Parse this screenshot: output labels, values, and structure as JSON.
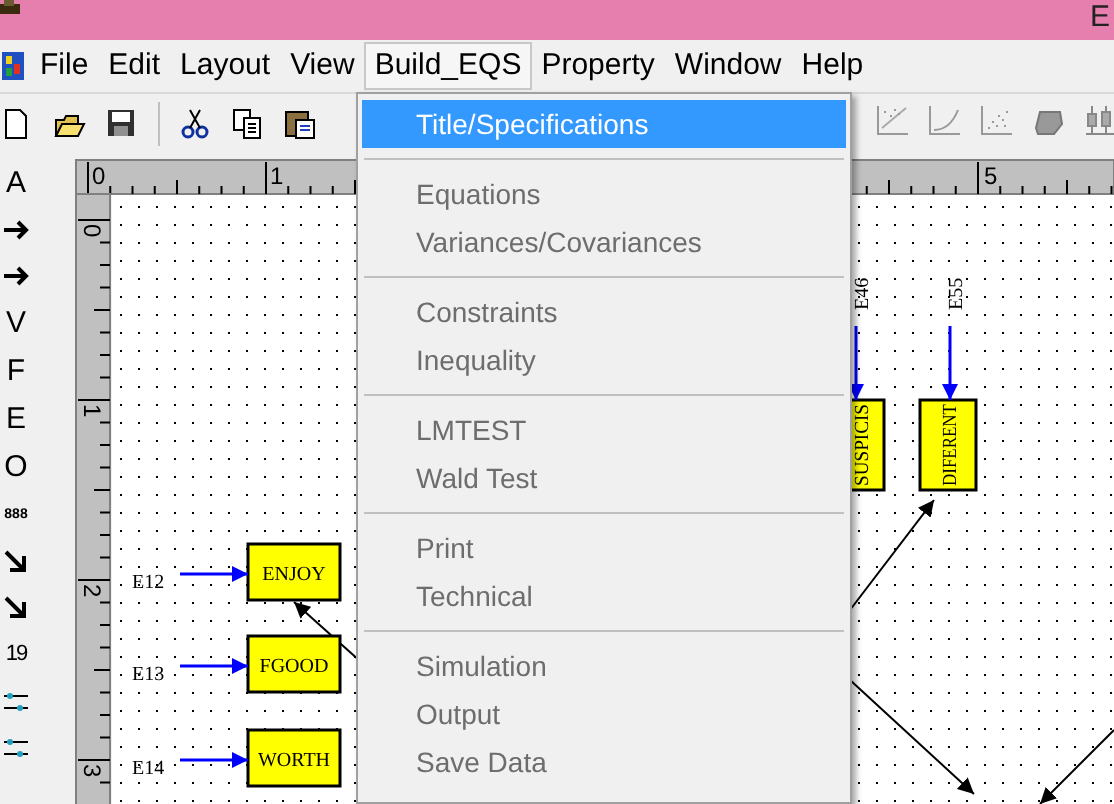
{
  "window": {
    "title": "E"
  },
  "menu_bar": [
    {
      "label": "File",
      "selected": false
    },
    {
      "label": "Edit",
      "selected": false
    },
    {
      "label": "Layout",
      "selected": false
    },
    {
      "label": "View",
      "selected": false
    },
    {
      "label": "Build_EQS",
      "selected": true
    },
    {
      "label": "Property",
      "selected": false
    },
    {
      "label": "Window",
      "selected": false
    },
    {
      "label": "Help",
      "selected": false
    }
  ],
  "toolbar": [
    {
      "kind": "new"
    },
    {
      "kind": "open"
    },
    {
      "kind": "save"
    },
    {
      "kind": "separator"
    },
    {
      "kind": "cut"
    },
    {
      "kind": "copy"
    },
    {
      "kind": "paste"
    }
  ],
  "toolbar_right": [
    {
      "kind": "scatter"
    },
    {
      "kind": "curve"
    },
    {
      "kind": "dots"
    },
    {
      "kind": "blob"
    },
    {
      "kind": "candles"
    }
  ],
  "tool_palette": [
    {
      "kind": "glyph",
      "text": "A"
    },
    {
      "kind": "arrow"
    },
    {
      "kind": "arrow"
    },
    {
      "kind": "glyph",
      "text": "V"
    },
    {
      "kind": "glyph",
      "text": "F"
    },
    {
      "kind": "glyph",
      "text": "E"
    },
    {
      "kind": "glyph",
      "text": "O"
    },
    {
      "kind": "glyph",
      "text": "888"
    },
    {
      "kind": "diagonal"
    },
    {
      "kind": "diagonal"
    },
    {
      "kind": "glyph",
      "text": "19"
    },
    {
      "kind": "beads"
    },
    {
      "kind": "beads"
    }
  ],
  "ruler": {
    "top_labels": [
      "0",
      "1",
      "5"
    ],
    "left_labels": [
      "0",
      "1",
      "2",
      "3"
    ]
  },
  "diagram": {
    "boxes": [
      {
        "label": "ENJOY",
        "kind": "horizontal"
      },
      {
        "label": "FGOOD",
        "kind": "horizontal"
      },
      {
        "label": "WORTH",
        "kind": "horizontal"
      },
      {
        "label": "SUSPICIS",
        "kind": "vertical"
      },
      {
        "label": "DIFERENT",
        "kind": "vertical"
      }
    ],
    "error_labels": [
      {
        "label": "E12",
        "kind": "horizontal"
      },
      {
        "label": "E13",
        "kind": "horizontal"
      },
      {
        "label": "E14",
        "kind": "horizontal"
      },
      {
        "label": "E46",
        "kind": "vertical"
      },
      {
        "label": "E55",
        "kind": "vertical"
      }
    ]
  },
  "build_eqs_menu": [
    [
      {
        "label": "Title/Specifications",
        "selected": true,
        "disabled": false
      }
    ],
    [
      {
        "label": "Equations",
        "selected": false,
        "disabled": true
      },
      {
        "label": "Variances/Covariances",
        "selected": false,
        "disabled": true
      }
    ],
    [
      {
        "label": "Constraints",
        "selected": false,
        "disabled": true
      },
      {
        "label": "Inequality",
        "selected": false,
        "disabled": true
      }
    ],
    [
      {
        "label": "LMTEST",
        "selected": false,
        "disabled": true
      },
      {
        "label": "Wald Test",
        "selected": false,
        "disabled": true
      }
    ],
    [
      {
        "label": "Print",
        "selected": false,
        "disabled": true
      },
      {
        "label": "Technical",
        "selected": false,
        "disabled": true
      }
    ],
    [
      {
        "label": "Simulation",
        "selected": false,
        "disabled": true
      },
      {
        "label": "Output",
        "selected": false,
        "disabled": true
      },
      {
        "label": "Save Data",
        "selected": false,
        "disabled": true
      }
    ]
  ]
}
